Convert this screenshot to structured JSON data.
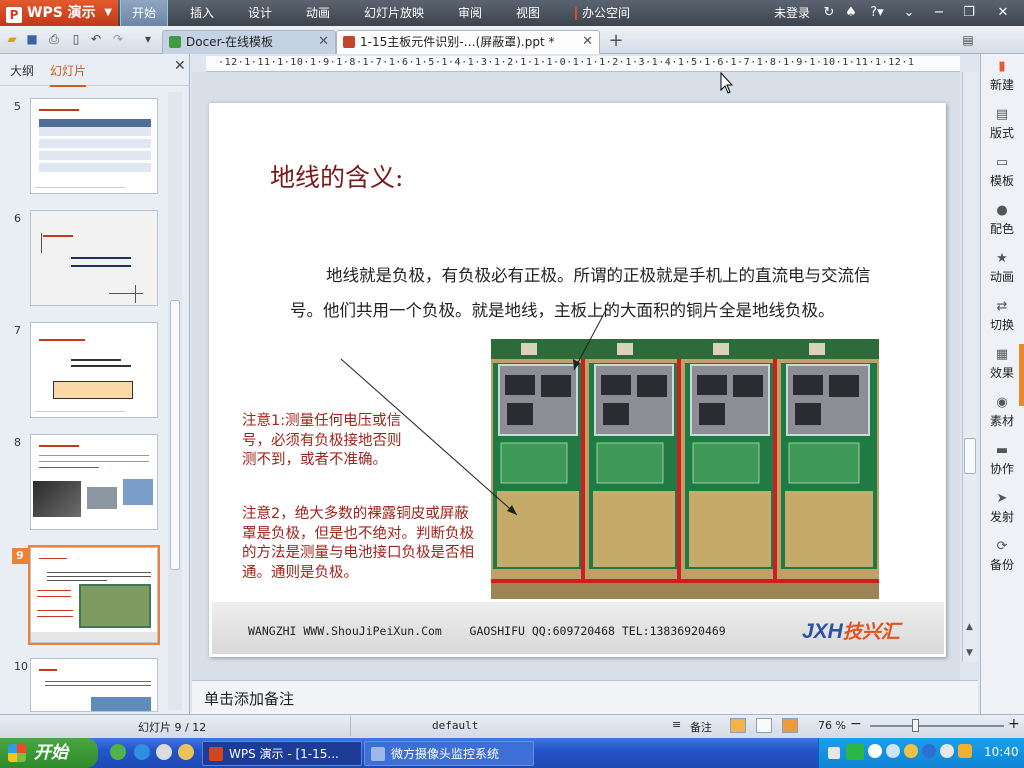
{
  "app": {
    "logo_text": "WPS 演示",
    "menu": [
      "开始",
      "插入",
      "设计",
      "动画",
      "幻灯片放映",
      "审阅",
      "视图",
      "办公空间"
    ],
    "active_menu": "开始",
    "login": "未登录"
  },
  "tabs": [
    {
      "label": "Docer-在线模板",
      "color": "#3d9a3d"
    },
    {
      "label": "1-15主板元件识别-…(屏蔽罩).ppt *",
      "color": "#c0452a"
    }
  ],
  "left_panel": {
    "tab_outline": "大纲",
    "tab_slides": "幻灯片",
    "thumbnails": [
      {
        "num": "5"
      },
      {
        "num": "6"
      },
      {
        "num": "7"
      },
      {
        "num": "8"
      },
      {
        "num": "9"
      },
      {
        "num": "10"
      }
    ]
  },
  "ruler": "·12·1·11·1·10·1·9·1·8·1·7·1·6·1·5·1·4·1·3·1·2·1·1·1·0·1·1·1·2·1·3·1·4·1·5·1·6·1·7·1·8·1·9·1·10·1·11·1·12·1",
  "slide": {
    "title": "地线的含义:",
    "body": "地线就是负极，有负极必有正极。所谓的正极就是手机上的直流电与交流信号。他们共用一个负极。就是地线，主板上的大面积的铜片全是地线负极。",
    "note1": "注意1:测量任何电压或信号，必须有负极接地否则测不到，或者不准确。",
    "note2": "注意2，绝大多数的裸露铜皮或屏蔽罩是负极，但是也不绝对。判断负极的方法是测量与电池接口负极是否相通。通则是负极。",
    "footer": "WANGZHI WWW.ShouJiPeiXun.Com    GAOSHIFU QQ:609720468 TEL:13836920469",
    "logo_latin": "JXH",
    "logo_cn": "技兴汇"
  },
  "notes_placeholder": "单击添加备注",
  "right_bar": [
    {
      "label": "新建",
      "icon": "new-icon",
      "glyph": "▮"
    },
    {
      "label": "版式",
      "icon": "layout-icon",
      "glyph": "▤"
    },
    {
      "label": "模板",
      "icon": "template-icon",
      "glyph": "▭"
    },
    {
      "label": "配色",
      "icon": "palette-icon",
      "glyph": "●"
    },
    {
      "label": "动画",
      "icon": "animation-icon",
      "glyph": "★"
    },
    {
      "label": "切换",
      "icon": "switch-icon",
      "glyph": "⇄"
    },
    {
      "label": "效果",
      "icon": "effect-icon",
      "glyph": "▦"
    },
    {
      "label": "素材",
      "icon": "material-icon",
      "glyph": "◉"
    },
    {
      "label": "协作",
      "icon": "collab-icon",
      "glyph": "▬"
    },
    {
      "label": "发射",
      "icon": "launch-icon",
      "glyph": "➤"
    },
    {
      "label": "备份",
      "icon": "backup-icon",
      "glyph": "⟳"
    }
  ],
  "status": {
    "slide_count": "幻灯片 9 / 12",
    "theme": "default",
    "notes": "备注",
    "zoom": "76 %"
  },
  "taskbar": {
    "start": "开始",
    "item1": "WPS 演示 - [1-15...",
    "item2": "微方摄像头监控系统",
    "clock": "10:40"
  },
  "colors": {
    "accent_orange": "#ef8034",
    "title_red": "#7a1a1a",
    "note_red": "#a1241c",
    "taskbar_blue": "#2354c8"
  }
}
